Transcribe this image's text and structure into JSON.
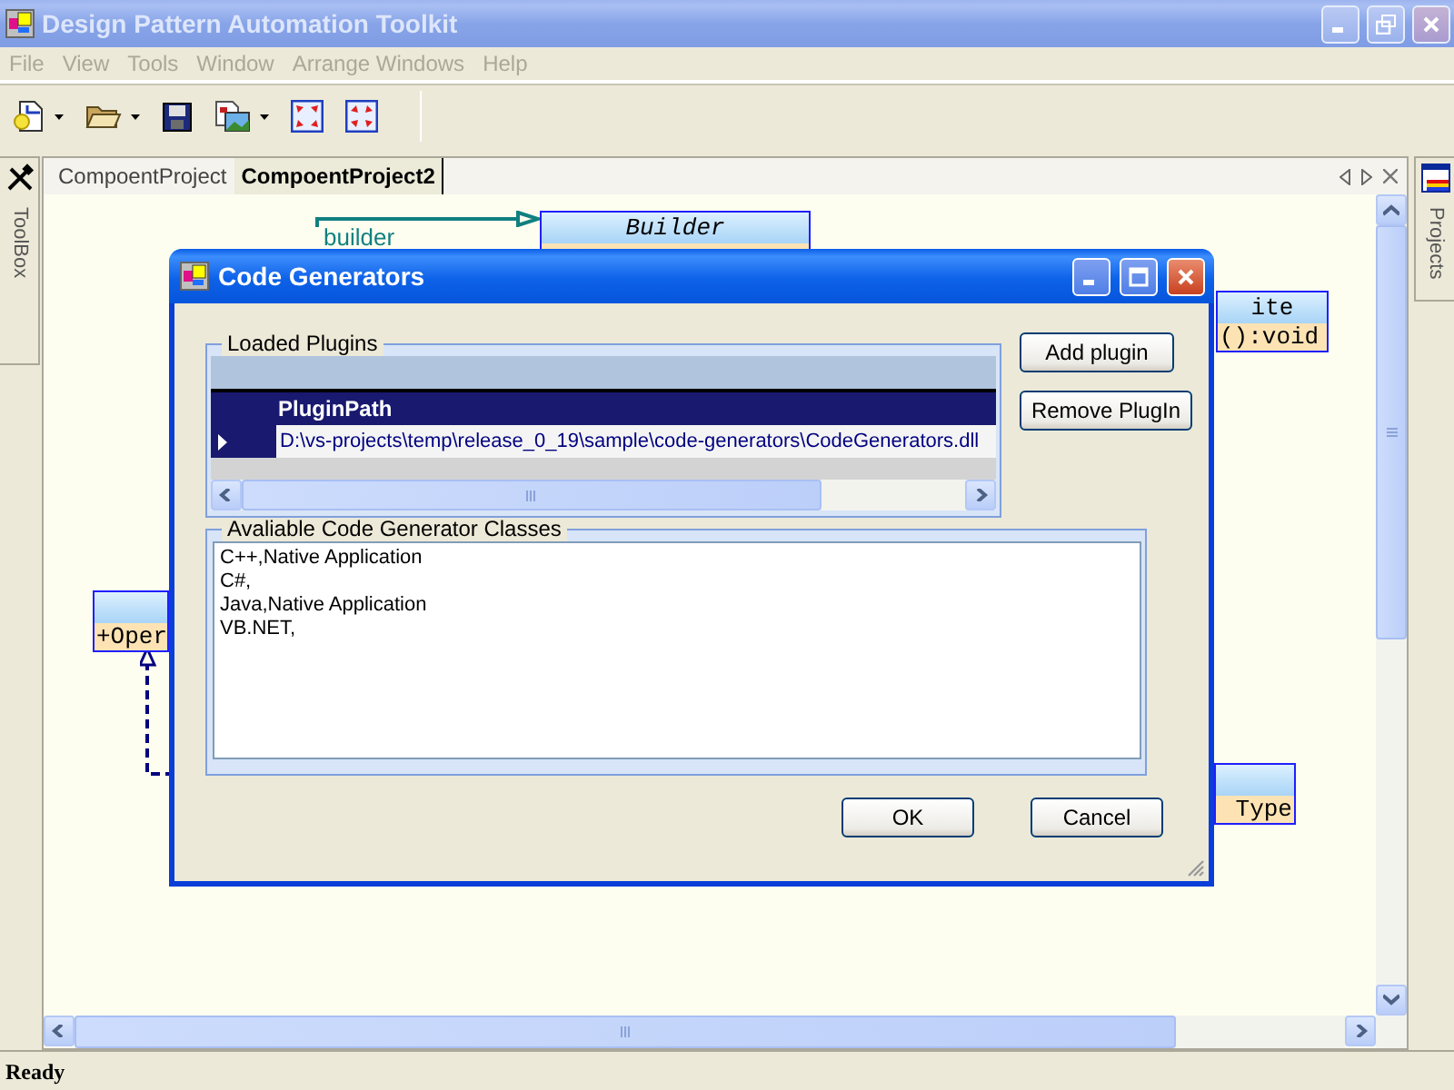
{
  "window": {
    "title": "Design Pattern Automation Toolkit",
    "active": false
  },
  "menu": [
    {
      "label": "File",
      "disabled": true
    },
    {
      "label": "View",
      "disabled": true
    },
    {
      "label": "Tools",
      "disabled": true
    },
    {
      "label": "Window",
      "disabled": true
    },
    {
      "label": "Arrange Windows",
      "disabled": true
    },
    {
      "label": "Help",
      "disabled": true
    }
  ],
  "toolbar": [
    {
      "kind": "new",
      "dropdown": true
    },
    {
      "kind": "open",
      "dropdown": true
    },
    {
      "kind": "save",
      "dropdown": false
    },
    {
      "kind": "image",
      "dropdown": true
    },
    {
      "kind": "expand",
      "dropdown": false
    },
    {
      "kind": "collapse",
      "dropdown": false
    }
  ],
  "toolbox_panel": {
    "label": "ToolBox"
  },
  "projects_panel": {
    "label": "Projects"
  },
  "document_tabs": [
    {
      "label": "CompoentProject",
      "selected": false
    },
    {
      "label": "CompoentProject2",
      "selected": true
    }
  ],
  "diagram": {
    "labels": [
      "builder"
    ],
    "classes": [
      {
        "name": "Builder",
        "italic": true
      },
      {
        "name": "ite",
        "italic": false,
        "members": [
          "():void"
        ]
      },
      {
        "members": [
          "+Oper"
        ]
      },
      {
        "members": [
          "Type"
        ]
      }
    ]
  },
  "dialog": {
    "title": "Code Generators",
    "plugins": {
      "legend": "Loaded Plugins",
      "column": "PluginPath",
      "rows": [
        {
          "path": "D:\\vs-projects\\temp\\release_0_19\\sample\\code-generators\\CodeGenerators.dll",
          "selected": true
        }
      ]
    },
    "side_buttons": [
      "Add plugin",
      "Remove PlugIn"
    ],
    "classes": {
      "legend": "Avaliable Code Generator Classes",
      "items": [
        "C++,Native Application",
        "C#,",
        "Java,Native Application",
        "VB.NET,"
      ]
    },
    "footer_buttons": [
      "OK",
      "Cancel"
    ]
  },
  "status_bar": {
    "text": "Ready"
  }
}
